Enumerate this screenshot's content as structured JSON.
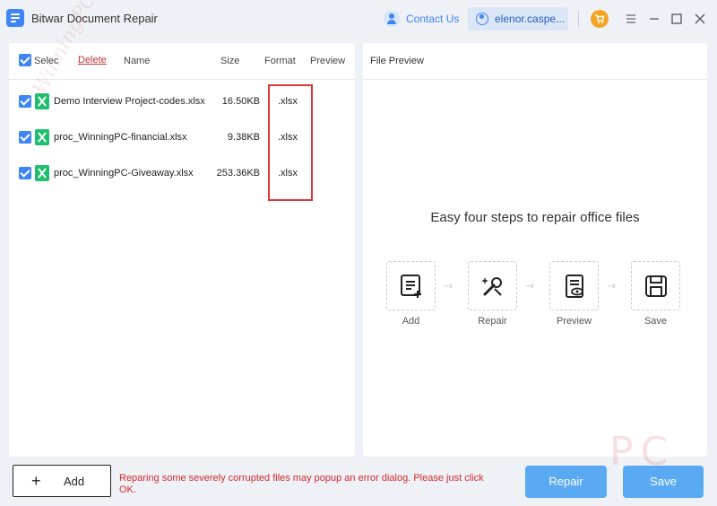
{
  "app": {
    "title": "Bitwar Document Repair"
  },
  "header": {
    "contact_label": "Contact Us",
    "user_label": "elenor.caspe...",
    "icons": [
      "app-logo-icon",
      "contact-icon",
      "user-icon",
      "cart-icon",
      "menu-icon",
      "minimize-icon",
      "maximize-icon",
      "close-icon"
    ]
  },
  "file_list": {
    "columns": {
      "select": "Selec",
      "delete": "Delete",
      "name": "Name",
      "size": "Size",
      "format": "Format",
      "preview": "Preview"
    },
    "rows": [
      {
        "name": "Demo Interview Project-codes.xlsx",
        "size": "16.50KB",
        "format": ".xlsx",
        "checked": true
      },
      {
        "name": "proc_WinningPC-financial.xlsx",
        "size": "9.38KB",
        "format": ".xlsx",
        "checked": true
      },
      {
        "name": "proc_WinningPC-Giveaway.xlsx",
        "size": "253.36KB",
        "format": ".xlsx",
        "checked": true
      }
    ]
  },
  "preview": {
    "title": "File Preview",
    "steps_title": "Easy four steps to repair office files",
    "steps": [
      {
        "label": "Add",
        "icon": "add-file-icon"
      },
      {
        "label": "Repair",
        "icon": "repair-tools-icon"
      },
      {
        "label": "Preview",
        "icon": "preview-document-icon"
      },
      {
        "label": "Save",
        "icon": "save-floppy-icon"
      }
    ]
  },
  "footer": {
    "add_label": "Add",
    "warning": "Reparing some severely corrupted files may popup an error dialog. Please just click OK.",
    "repair_label": "Repair",
    "save_label": "Save"
  },
  "colors": {
    "accent": "#3f86f5",
    "button": "#5aa9f3",
    "warning": "#d42a2a",
    "excel": "#1fbf6e",
    "highlight": "#e03535"
  },
  "watermark": {
    "text": "WinningPC",
    "corner": "PC"
  }
}
